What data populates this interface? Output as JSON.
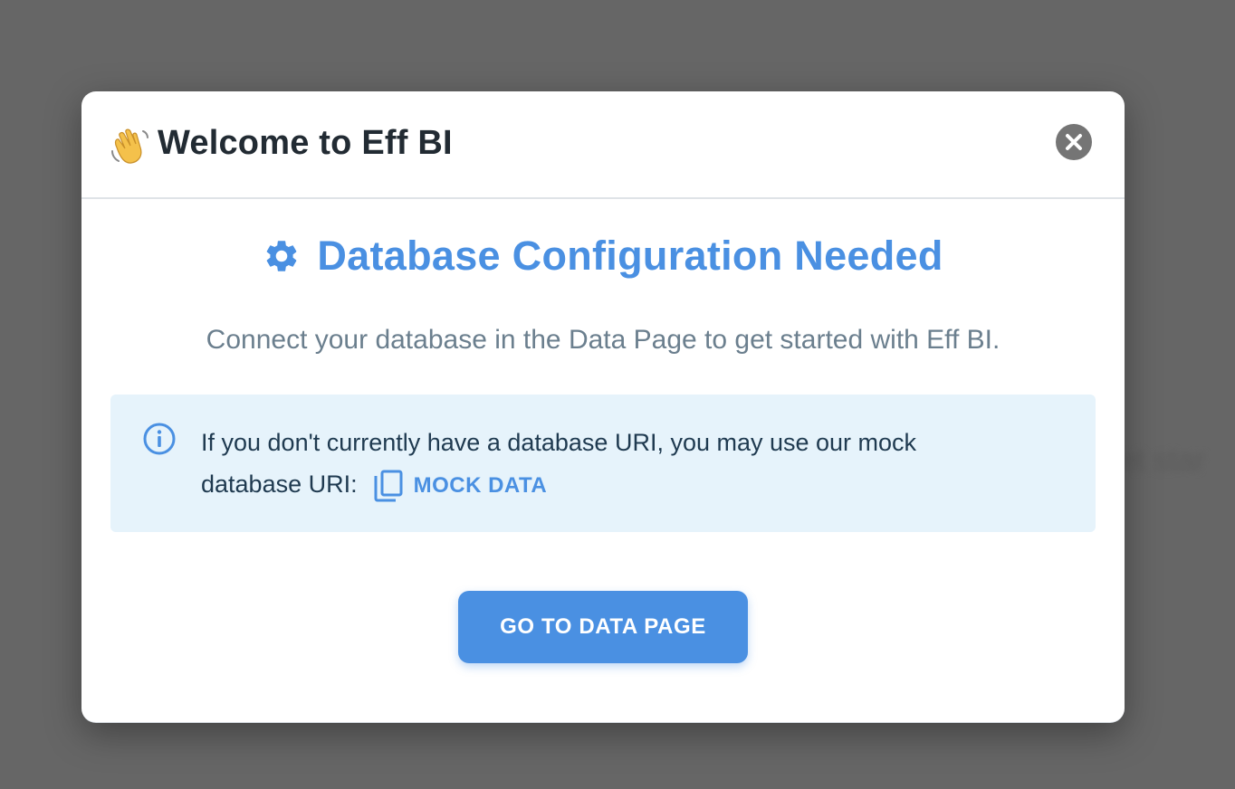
{
  "background": {
    "partial_text": "et star"
  },
  "modal": {
    "header": {
      "wave_icon": "waving-hand-icon",
      "title": "Welcome to Eff BI",
      "close_icon": "close-icon"
    },
    "heading": {
      "icon": "gear-icon",
      "title": "Database Configuration Needed"
    },
    "description": "Connect your database in the Data Page to get started with Eff BI.",
    "info": {
      "icon": "info-icon",
      "text": "If you don't currently have a database URI, you may use our mock database URI:",
      "link_icon": "copy-icon",
      "link_label": "MOCK DATA"
    },
    "primary_button_label": "GO TO DATA PAGE"
  },
  "colors": {
    "accent": "#4a90e2",
    "info_bg": "#e6f3fb",
    "title": "#222b33",
    "muted_text": "#6b7f8e",
    "close_bg": "#757575",
    "backdrop": "#666666"
  }
}
